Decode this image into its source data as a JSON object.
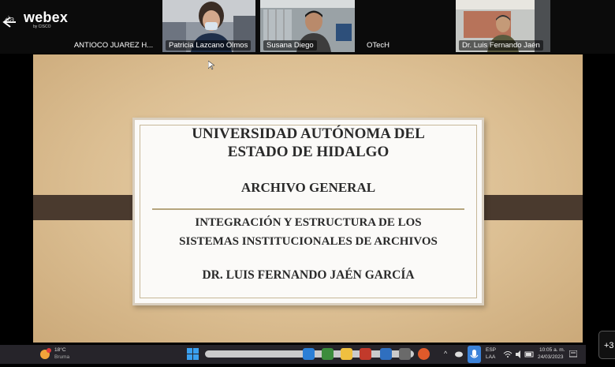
{
  "header": {
    "back_text": "‹ia",
    "logo_text": "webex",
    "logo_sub": "by CISCO"
  },
  "participants": [
    {
      "name": "ANTIOCO JUAREZ H..."
    },
    {
      "name": "Patricia Lazcano Olmos"
    },
    {
      "name": "Susana Diego"
    },
    {
      "name": "OTecH"
    },
    {
      "name": "Dr. Luis Fernando Jaén"
    }
  ],
  "slide": {
    "title_line1": "UNIVERSIDAD AUTÓNOMA DEL",
    "title_line2": "ESTADO DE HIDALGO",
    "department": "ARCHIVO GENERAL",
    "topic_line1": "INTEGRACIÓN Y ESTRUCTURA DE LOS",
    "topic_line2": "SISTEMAS INSTITUCIONALES DE ARCHIVOS",
    "presenter": "DR. LUIS FERNANDO JAÉN GARCÍA"
  },
  "side_button": {
    "label": "+3"
  },
  "taskbar": {
    "weather_temp": "18°C",
    "weather_desc": "Bruma",
    "lang_top": "ESP",
    "lang_bottom": "LAA",
    "time": "10:05 a. m.",
    "date": "24/03/2023"
  },
  "colors": {
    "slide_bg": "#dcbf93",
    "band": "#4a3a2e",
    "card": "#fbfaf8",
    "text": "#2a2a2a"
  }
}
